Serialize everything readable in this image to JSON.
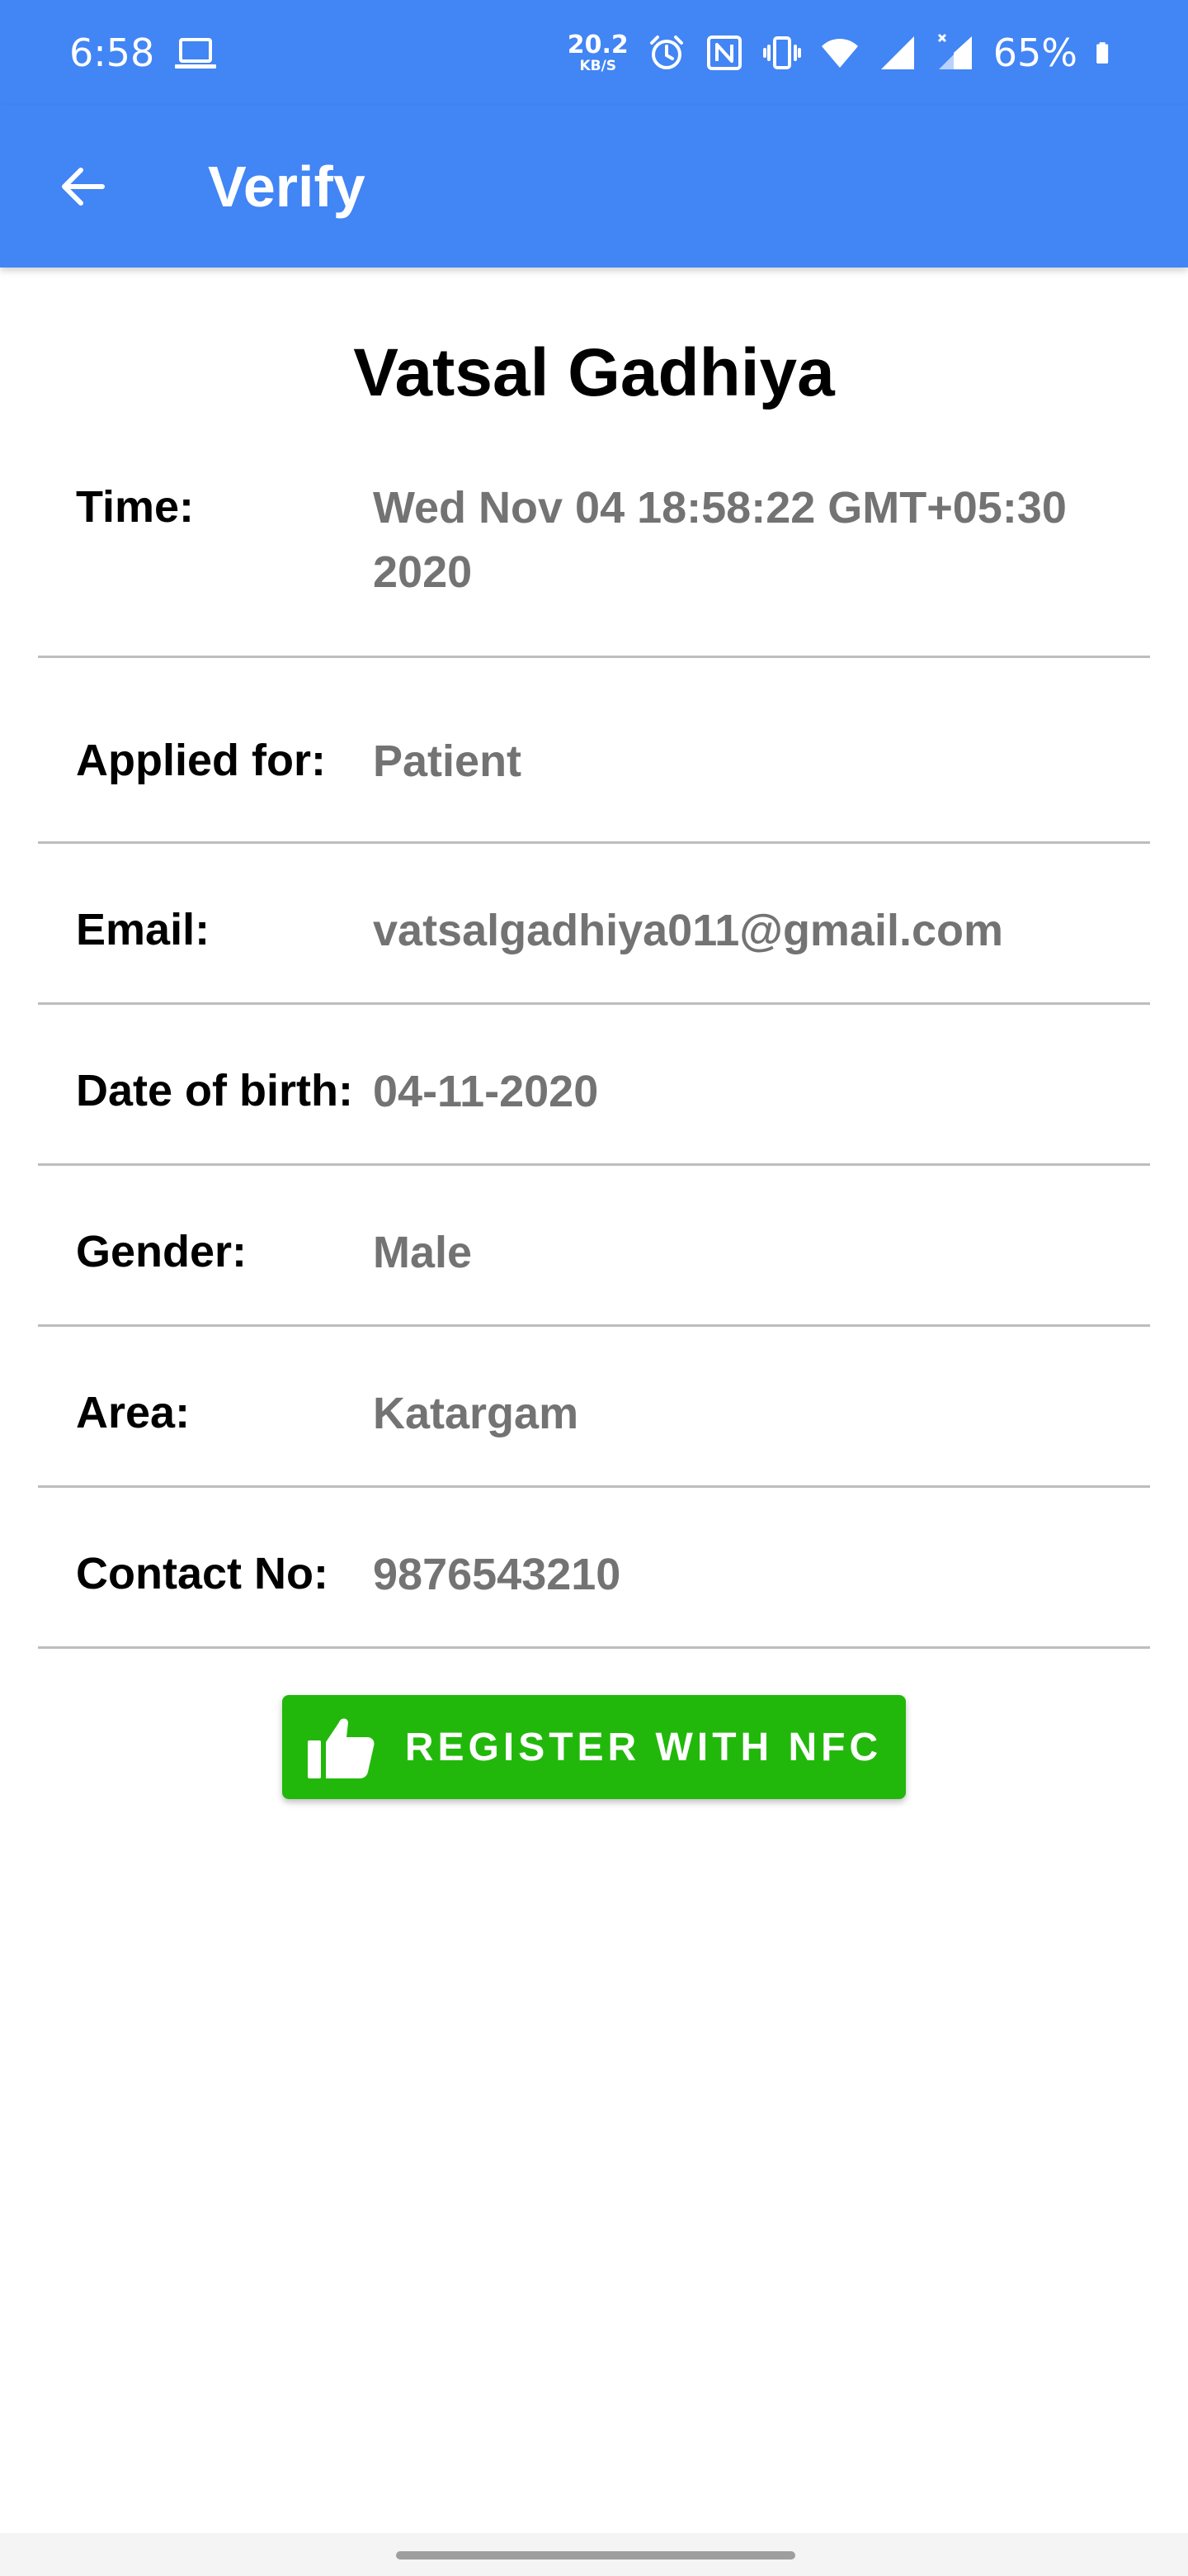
{
  "status_bar": {
    "time": "6:58",
    "net_speed_value": "20.2",
    "net_speed_unit": "KB/S",
    "battery_percent": "65%",
    "icons": [
      "laptop-icon",
      "alarm-icon",
      "nfc-icon",
      "vibrate-icon",
      "wifi-icon",
      "signal-icon",
      "signal-no-data-icon",
      "battery-icon"
    ]
  },
  "app_bar": {
    "back_icon": "arrow-back-icon",
    "title": "Verify"
  },
  "profile": {
    "name": "Vatsal Gadhiya"
  },
  "details": [
    {
      "label": "Time:",
      "value": "Wed Nov 04 18:58:22 GMT+05:30 2020"
    },
    {
      "label": "Applied for:",
      "value": "Patient"
    },
    {
      "label": "Email:",
      "value": "vatsalgadhiya011@gmail.com"
    },
    {
      "label": "Date of birth:",
      "value": "04-11-2020"
    },
    {
      "label": "Gender:",
      "value": "Male"
    },
    {
      "label": "Area:",
      "value": "Katargam"
    },
    {
      "label": "Contact No:",
      "value": "9876543210"
    }
  ],
  "action": {
    "label": "REGISTER WITH NFC",
    "icon": "thumbs-up-icon"
  },
  "colors": {
    "primary": "#4285f4",
    "button": "#22b80b",
    "value_text": "#737373",
    "divider": "#bdbdbd"
  }
}
